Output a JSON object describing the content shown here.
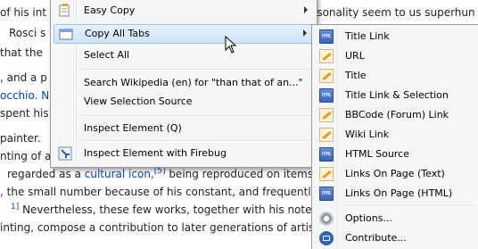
{
  "article": {
    "lines": [
      {
        "pre": "of his int",
        "link": "",
        "post": ""
      },
      {
        "pre": "Rosci s",
        "link": "",
        "post": ""
      },
      {
        "pre": "that the",
        "link": "",
        "post": ""
      },
      {
        "pre": ", and a p",
        "link": "",
        "post": ""
      },
      {
        "pre": "",
        "link": "occhio. N",
        "post": ""
      },
      {
        "pre": "spent his",
        "link": "",
        "post": ""
      },
      {
        "pre": "painter.",
        "link": "",
        "post": ""
      },
      {
        "pre": "nting of a",
        "link": "",
        "post": ""
      },
      {
        "pre": "regarded as a ",
        "link": "cultural icon,",
        "sup": "[5]",
        "post": " being reproduced on items "
      },
      {
        "pre": ", the small number because of his constant, and frequently",
        "link": "",
        "post": ""
      },
      {
        "pre": "",
        "sup": "1]",
        "post": " Nevertheless, these few works, together with his notebo"
      },
      {
        "pre": "inting, compose a contribution to later generations of artist",
        "link": "",
        "post": ""
      }
    ],
    "top_right": "ersonality seem to us superhun"
  },
  "menu": {
    "items": [
      {
        "label": "Easy Copy",
        "has_submenu": true,
        "icon": "easy-copy-icon"
      },
      {
        "label": "Copy All Tabs",
        "has_submenu": true,
        "icon": "copy-all-tabs-icon",
        "highlighted": true
      },
      {
        "label": "Select All",
        "has_submenu": false
      },
      {
        "label": "Search Wikipedia (en) for \"than that of an...\"",
        "has_submenu": false
      },
      {
        "label": "View Selection Source",
        "has_submenu": false
      },
      {
        "label": "Inspect Element (Q)",
        "has_submenu": false
      },
      {
        "label": "Inspect Element with Firebug",
        "has_submenu": false,
        "icon": "firebug-icon"
      }
    ]
  },
  "submenu": {
    "items": [
      {
        "label": "Title Link",
        "icon": "html-icon"
      },
      {
        "label": "URL",
        "icon": "pencil-icon"
      },
      {
        "label": "Title",
        "icon": "pencil-icon"
      },
      {
        "label": "Title Link & Selection",
        "icon": "html-icon"
      },
      {
        "label": "BBCode (Forum) Link",
        "icon": "pencil-icon"
      },
      {
        "label": "Wiki Link",
        "icon": "pencil-icon"
      },
      {
        "label": "HTML Source",
        "icon": "html-icon"
      },
      {
        "label": "Links On Page (Text)",
        "icon": "pencil-icon"
      },
      {
        "label": "Links On Page (HTML)",
        "icon": "html-icon"
      },
      {
        "label": "Options...",
        "icon": "gear-icon"
      },
      {
        "label": "Contribute...",
        "icon": "contribute-icon"
      }
    ]
  },
  "colors": {
    "link": "#0645ad",
    "menu_bg": "#f5f6f7",
    "highlight": "#cfe3f8"
  }
}
